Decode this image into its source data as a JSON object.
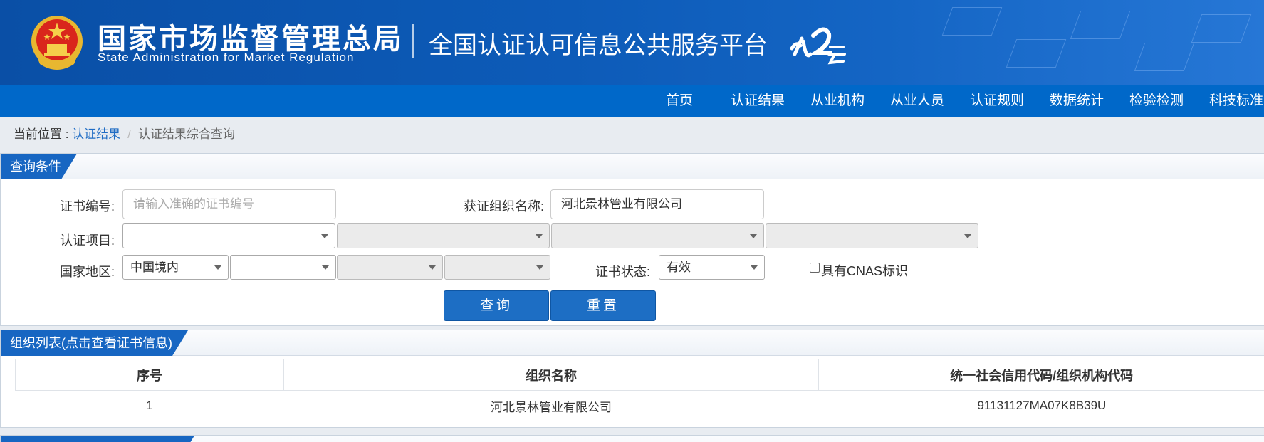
{
  "header": {
    "org_cn": "国家市场监督管理总局",
    "org_en": "State Administration  for  Market Regulation",
    "platform_title": "全国认证认可信息公共服务平台",
    "colors": {
      "banner": "#0d5bb8",
      "nav": "#0068c9",
      "accent": "#1766c2"
    }
  },
  "nav": {
    "items": [
      {
        "label": "首页"
      },
      {
        "label": "认证结果"
      },
      {
        "label": "从业机构"
      },
      {
        "label": "从业人员"
      },
      {
        "label": "认证规则"
      },
      {
        "label": "数据统计"
      },
      {
        "label": "检验检测"
      },
      {
        "label": "科技标准"
      }
    ]
  },
  "breadcrumb": {
    "prefix": "当前位置 : ",
    "link": "认证结果",
    "separator": "/",
    "current": "认证结果综合查询"
  },
  "query": {
    "title": "查询条件",
    "cert_no_label": "证书编号:",
    "cert_no_placeholder": "请输入准确的证书编号",
    "org_name_label": "获证组织名称:",
    "org_name_value": "河北景林管业有限公司",
    "project_label": "认证项目:",
    "region_label": "国家地区:",
    "region_value": "中国境内",
    "status_label": "证书状态:",
    "status_value": "有效",
    "cnas_label": "具有CNAS标识",
    "cnas_checked": false,
    "search_button": "查询",
    "reset_button": "重置"
  },
  "results": {
    "title": "组织列表(点击查看证书信息)",
    "columns": [
      "序号",
      "组织名称",
      "统一社会信用代码/组织机构代码"
    ],
    "rows": [
      [
        "1",
        "河北景林管业有限公司",
        "91131127MA07K8B39U"
      ]
    ]
  }
}
